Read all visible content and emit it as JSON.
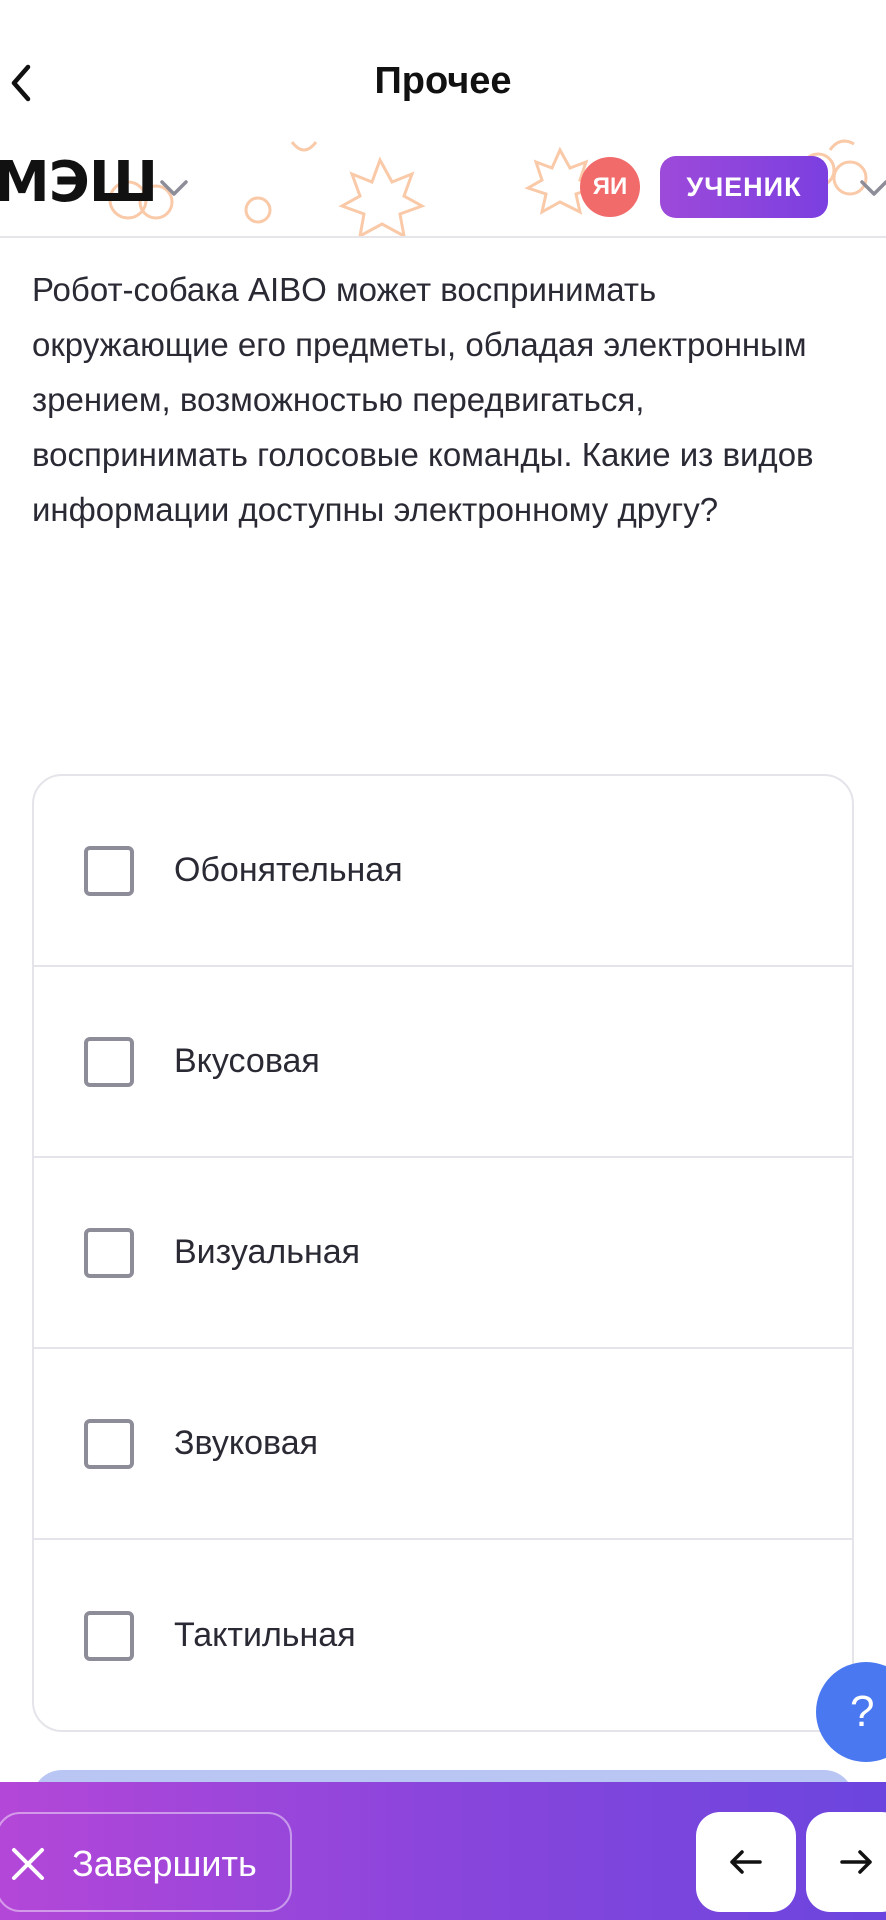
{
  "header": {
    "title": "Прочее",
    "back_icon": "chevron-left-icon"
  },
  "brand": {
    "logo": "МЭШ",
    "avatar_initials": "ЯИ",
    "role": "УЧЕНИК",
    "avatar_color": "#f26b6b",
    "role_color": "#8e44de",
    "decor_color": "#f9c9a8"
  },
  "question": {
    "text": "Робот-собака AIBO может воспринимать окружающие его предметы, обладая электронным зрением, возможностью передвигаться, воспринимать голосовые команды. Какие из видов информации доступны электронному другу?"
  },
  "answers": [
    {
      "label": "Обонятельная",
      "checked": false
    },
    {
      "label": "Вкусовая",
      "checked": false
    },
    {
      "label": "Визуальная",
      "checked": false
    },
    {
      "label": "Звуковая",
      "checked": false
    },
    {
      "label": "Тактильная",
      "checked": false
    }
  ],
  "help": {
    "label": "?",
    "color": "#4a78f0"
  },
  "footer": {
    "finish_label": "Завершить",
    "prev_icon": "arrow-left-icon",
    "next_icon": "arrow-right-icon",
    "gradient_start": "#b347d8",
    "gradient_end": "#6b45de"
  }
}
